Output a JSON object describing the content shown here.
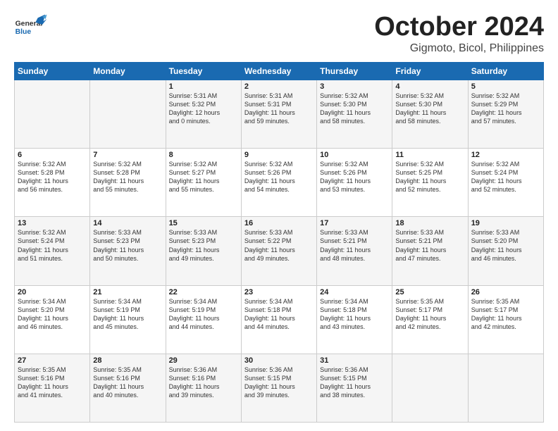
{
  "header": {
    "logo_general": "General",
    "logo_blue": "Blue",
    "month_title": "October 2024",
    "location": "Gigmoto, Bicol, Philippines"
  },
  "weekdays": [
    "Sunday",
    "Monday",
    "Tuesday",
    "Wednesday",
    "Thursday",
    "Friday",
    "Saturday"
  ],
  "weeks": [
    [
      {
        "day": "",
        "info": ""
      },
      {
        "day": "",
        "info": ""
      },
      {
        "day": "1",
        "info": "Sunrise: 5:31 AM\nSunset: 5:32 PM\nDaylight: 12 hours\nand 0 minutes."
      },
      {
        "day": "2",
        "info": "Sunrise: 5:31 AM\nSunset: 5:31 PM\nDaylight: 11 hours\nand 59 minutes."
      },
      {
        "day": "3",
        "info": "Sunrise: 5:32 AM\nSunset: 5:30 PM\nDaylight: 11 hours\nand 58 minutes."
      },
      {
        "day": "4",
        "info": "Sunrise: 5:32 AM\nSunset: 5:30 PM\nDaylight: 11 hours\nand 58 minutes."
      },
      {
        "day": "5",
        "info": "Sunrise: 5:32 AM\nSunset: 5:29 PM\nDaylight: 11 hours\nand 57 minutes."
      }
    ],
    [
      {
        "day": "6",
        "info": "Sunrise: 5:32 AM\nSunset: 5:28 PM\nDaylight: 11 hours\nand 56 minutes."
      },
      {
        "day": "7",
        "info": "Sunrise: 5:32 AM\nSunset: 5:28 PM\nDaylight: 11 hours\nand 55 minutes."
      },
      {
        "day": "8",
        "info": "Sunrise: 5:32 AM\nSunset: 5:27 PM\nDaylight: 11 hours\nand 55 minutes."
      },
      {
        "day": "9",
        "info": "Sunrise: 5:32 AM\nSunset: 5:26 PM\nDaylight: 11 hours\nand 54 minutes."
      },
      {
        "day": "10",
        "info": "Sunrise: 5:32 AM\nSunset: 5:26 PM\nDaylight: 11 hours\nand 53 minutes."
      },
      {
        "day": "11",
        "info": "Sunrise: 5:32 AM\nSunset: 5:25 PM\nDaylight: 11 hours\nand 52 minutes."
      },
      {
        "day": "12",
        "info": "Sunrise: 5:32 AM\nSunset: 5:24 PM\nDaylight: 11 hours\nand 52 minutes."
      }
    ],
    [
      {
        "day": "13",
        "info": "Sunrise: 5:32 AM\nSunset: 5:24 PM\nDaylight: 11 hours\nand 51 minutes."
      },
      {
        "day": "14",
        "info": "Sunrise: 5:33 AM\nSunset: 5:23 PM\nDaylight: 11 hours\nand 50 minutes."
      },
      {
        "day": "15",
        "info": "Sunrise: 5:33 AM\nSunset: 5:23 PM\nDaylight: 11 hours\nand 49 minutes."
      },
      {
        "day": "16",
        "info": "Sunrise: 5:33 AM\nSunset: 5:22 PM\nDaylight: 11 hours\nand 49 minutes."
      },
      {
        "day": "17",
        "info": "Sunrise: 5:33 AM\nSunset: 5:21 PM\nDaylight: 11 hours\nand 48 minutes."
      },
      {
        "day": "18",
        "info": "Sunrise: 5:33 AM\nSunset: 5:21 PM\nDaylight: 11 hours\nand 47 minutes."
      },
      {
        "day": "19",
        "info": "Sunrise: 5:33 AM\nSunset: 5:20 PM\nDaylight: 11 hours\nand 46 minutes."
      }
    ],
    [
      {
        "day": "20",
        "info": "Sunrise: 5:34 AM\nSunset: 5:20 PM\nDaylight: 11 hours\nand 46 minutes."
      },
      {
        "day": "21",
        "info": "Sunrise: 5:34 AM\nSunset: 5:19 PM\nDaylight: 11 hours\nand 45 minutes."
      },
      {
        "day": "22",
        "info": "Sunrise: 5:34 AM\nSunset: 5:19 PM\nDaylight: 11 hours\nand 44 minutes."
      },
      {
        "day": "23",
        "info": "Sunrise: 5:34 AM\nSunset: 5:18 PM\nDaylight: 11 hours\nand 44 minutes."
      },
      {
        "day": "24",
        "info": "Sunrise: 5:34 AM\nSunset: 5:18 PM\nDaylight: 11 hours\nand 43 minutes."
      },
      {
        "day": "25",
        "info": "Sunrise: 5:35 AM\nSunset: 5:17 PM\nDaylight: 11 hours\nand 42 minutes."
      },
      {
        "day": "26",
        "info": "Sunrise: 5:35 AM\nSunset: 5:17 PM\nDaylight: 11 hours\nand 42 minutes."
      }
    ],
    [
      {
        "day": "27",
        "info": "Sunrise: 5:35 AM\nSunset: 5:16 PM\nDaylight: 11 hours\nand 41 minutes."
      },
      {
        "day": "28",
        "info": "Sunrise: 5:35 AM\nSunset: 5:16 PM\nDaylight: 11 hours\nand 40 minutes."
      },
      {
        "day": "29",
        "info": "Sunrise: 5:36 AM\nSunset: 5:16 PM\nDaylight: 11 hours\nand 39 minutes."
      },
      {
        "day": "30",
        "info": "Sunrise: 5:36 AM\nSunset: 5:15 PM\nDaylight: 11 hours\nand 39 minutes."
      },
      {
        "day": "31",
        "info": "Sunrise: 5:36 AM\nSunset: 5:15 PM\nDaylight: 11 hours\nand 38 minutes."
      },
      {
        "day": "",
        "info": ""
      },
      {
        "day": "",
        "info": ""
      }
    ]
  ]
}
